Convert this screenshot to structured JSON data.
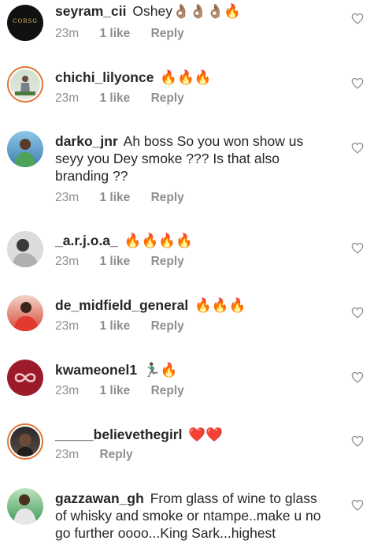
{
  "comments": [
    {
      "username": "seyram_cii",
      "text": "Oshey",
      "emoji": "👌🏽👌🏽👌🏽🔥",
      "time": "23m",
      "likes": "1 like",
      "reply": "Reply"
    },
    {
      "username": "chichi_lilyonce",
      "text": "",
      "emoji": "🔥🔥🔥",
      "time": "23m",
      "likes": "1 like",
      "reply": "Reply"
    },
    {
      "username": "darko_jnr",
      "text": "Ah boss So you won show us seyy you Dey smoke ??? Is that also branding ??",
      "emoji": "",
      "time": "23m",
      "likes": "1 like",
      "reply": "Reply"
    },
    {
      "username": "_a.r.j.o.a_",
      "text": "",
      "emoji": "🔥🔥🔥🔥",
      "time": "23m",
      "likes": "1 like",
      "reply": "Reply"
    },
    {
      "username": "de_midfield_general",
      "text": "",
      "emoji": "🔥🔥🔥",
      "time": "23m",
      "likes": "1 like",
      "reply": "Reply"
    },
    {
      "username": "kwameonel1",
      "text": "",
      "emoji": "🏃🏾‍♂️🔥",
      "time": "23m",
      "likes": "1 like",
      "reply": "Reply"
    },
    {
      "username": "_____believethegirl",
      "text": "",
      "emoji": "❤️❤️",
      "time": "23m",
      "likes": "",
      "reply": "Reply"
    },
    {
      "username": "gazzawan_gh",
      "text": "From glass of wine to glass of whisky and smoke or ntampe..make u no go further oooo...King Sark...highest",
      "emoji": "",
      "time": "",
      "likes": "",
      "reply": ""
    }
  ],
  "avatar0_label": "CORSG",
  "colors": {
    "fire": "#f0561d",
    "heart_red": "#e0162b",
    "meta_gray": "#8e8e8e",
    "kwame_avatar": "#9b1b2a"
  }
}
